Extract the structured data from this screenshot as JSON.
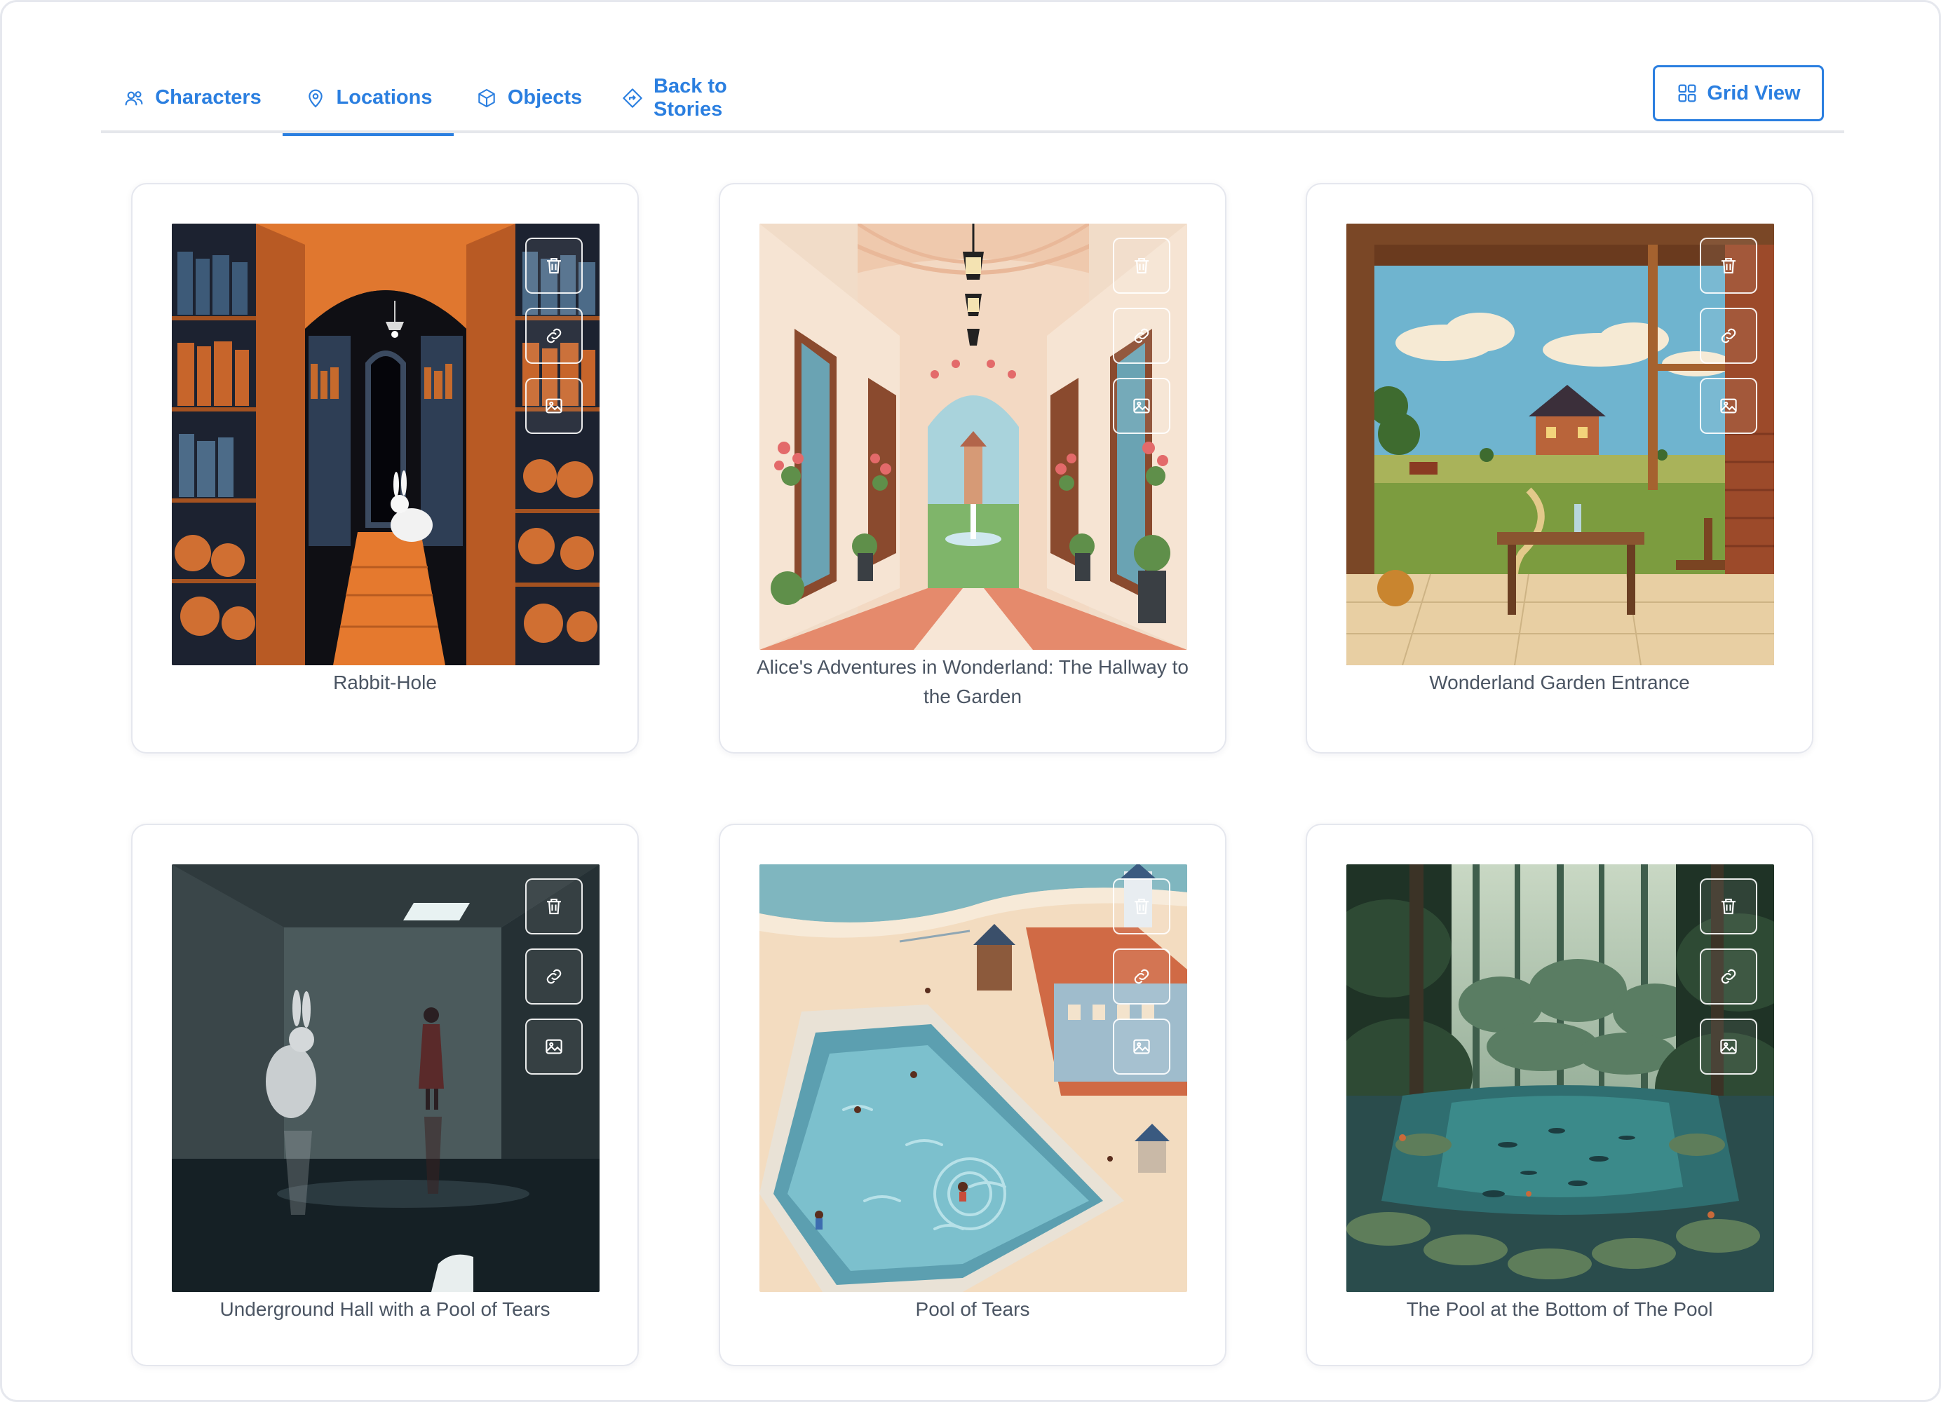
{
  "nav": {
    "tabs": [
      {
        "id": "characters",
        "label": "Characters",
        "icon": "users-icon"
      },
      {
        "id": "locations",
        "label": "Locations",
        "icon": "map-pin-icon",
        "active": true
      },
      {
        "id": "objects",
        "label": "Objects",
        "icon": "cube-icon"
      },
      {
        "id": "back",
        "label": "Back to Stories",
        "icon": "signpost-icon"
      }
    ],
    "grid_view_label": "Grid View"
  },
  "locations": [
    {
      "title": "Rabbit-Hole",
      "scene": "library-tunnel"
    },
    {
      "title": "Alice's Adventures in Wonderland: The Hallway to the Garden",
      "scene": "hallway-garden"
    },
    {
      "title": "Wonderland Garden Entrance",
      "scene": "porch-countryside"
    },
    {
      "title": "Underground Hall with a Pool of Tears",
      "scene": "dark-hall-pool"
    },
    {
      "title": "Pool of Tears",
      "scene": "beach-pool"
    },
    {
      "title": "The Pool at the Bottom of The Pool",
      "scene": "forest-pond"
    }
  ],
  "card_actions": [
    {
      "icon": "trash-icon"
    },
    {
      "icon": "link-icon"
    },
    {
      "icon": "image-icon"
    }
  ],
  "colors": {
    "accent": "#2b7fe0",
    "caption": "#4b5563"
  }
}
